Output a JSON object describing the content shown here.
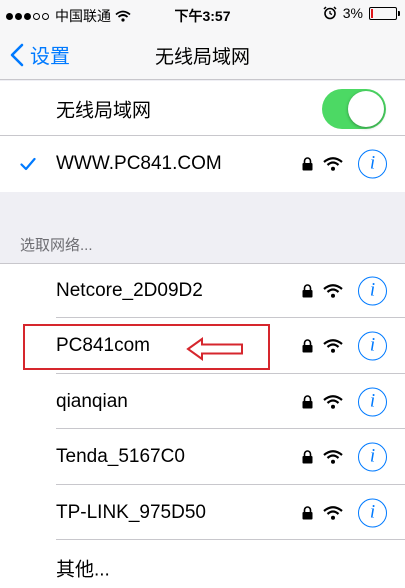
{
  "status_bar": {
    "carrier": "中国联通",
    "time": "下午3:57",
    "battery": "3%"
  },
  "nav": {
    "back_label": "设置",
    "title": "无线局域网"
  },
  "wifi_toggle": {
    "label": "无线局域网",
    "on": true
  },
  "connected": {
    "name": "WWW.PC841.COM"
  },
  "section_header": "选取网络...",
  "networks": [
    {
      "name": "Netcore_2D09D2"
    },
    {
      "name": "PC841com"
    },
    {
      "name": "qianqian"
    },
    {
      "name": "Tenda_5167C0"
    },
    {
      "name": "TP-LINK_975D50"
    }
  ],
  "other_label": "其他...",
  "icons": {
    "lock": "lock-icon",
    "wifi": "wifi-icon",
    "info": "info-icon",
    "check": "checkmark-icon",
    "back": "chevron-left-icon",
    "alarm": "alarm-icon"
  },
  "colors": {
    "accent": "#007aff",
    "toggle_on": "#4cd964",
    "annotation": "#d6262d",
    "background": "#efeff4"
  }
}
